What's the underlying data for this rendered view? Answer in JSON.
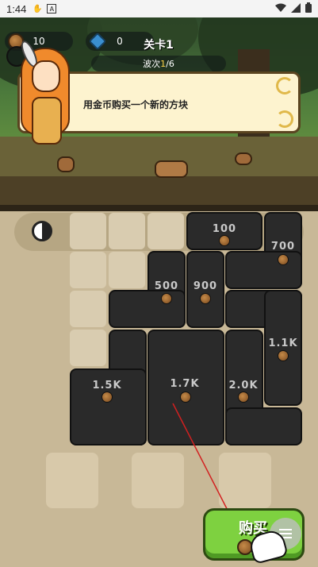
{
  "status_bar": {
    "time": "1:44",
    "icons_left": [
      "hand-icon",
      "a-icon"
    ],
    "icons_right": [
      "wifi-icon",
      "signal-icon",
      "battery-icon"
    ]
  },
  "resources": {
    "coins": "10",
    "gems": "0"
  },
  "level": {
    "title": "关卡1",
    "wave_label": "波次",
    "wave_current": "1",
    "wave_total": "/6"
  },
  "tutorial": {
    "message": "用金币购买一个新的方块"
  },
  "blocks": [
    {
      "id": "b100",
      "label": "100"
    },
    {
      "id": "b700",
      "label": "700"
    },
    {
      "id": "b500",
      "label": "500"
    },
    {
      "id": "b900",
      "label": "900"
    },
    {
      "id": "b1_1k",
      "label": "1.1K"
    },
    {
      "id": "b1_5k",
      "label": "1.5K"
    },
    {
      "id": "b1_7k",
      "label": "1.7K"
    },
    {
      "id": "b2_0k",
      "label": "2.0K"
    }
  ],
  "buy_button": {
    "label": "购买"
  },
  "colors": {
    "buy_green": "#7ed140",
    "block_dark": "#2a2a2a",
    "speech_bg": "#fdf3cf",
    "hint_red": "#d22020"
  }
}
